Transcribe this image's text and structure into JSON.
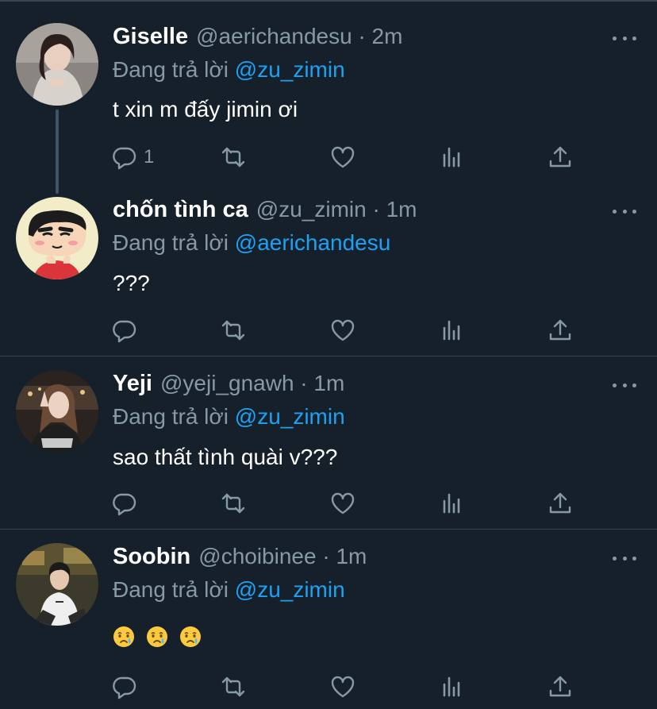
{
  "colors": {
    "background": "#15202b",
    "divider": "#38444d",
    "secondary_text": "#8899a6",
    "link": "#1da1f2"
  },
  "tweets": [
    {
      "name": "Giselle",
      "meta": "@aerichandesu · 2m",
      "replying_prefix": "Đang trả lời",
      "replying_handle": "@zu_zimin",
      "text": "t xin m đấy jimin ơi",
      "reply_count": "1",
      "avatar": "photo-girl-avatar"
    },
    {
      "name": "chốn tình ca",
      "meta": "@zu_zimin · 1m",
      "replying_prefix": "Đang trả lời",
      "replying_handle": "@aerichandesu",
      "text": "???",
      "reply_count": "",
      "avatar": "cartoon-boy-avatar"
    },
    {
      "name": "Yeji",
      "meta": "@yeji_gnawh · 1m",
      "replying_prefix": "Đang trả lời",
      "replying_handle": "@zu_zimin",
      "text": "sao thất tình quài v???",
      "reply_count": "",
      "avatar": "photo-girl-peace-avatar"
    },
    {
      "name": "Soobin",
      "meta": "@choibinee · 1m",
      "replying_prefix": "Đang trả lời",
      "replying_handle": "@zu_zimin",
      "text": "",
      "emojis": [
        "crying-face-icon",
        "crying-face-icon",
        "crying-face-icon"
      ],
      "reply_count": "",
      "avatar": "photo-boy-avatar"
    }
  ]
}
